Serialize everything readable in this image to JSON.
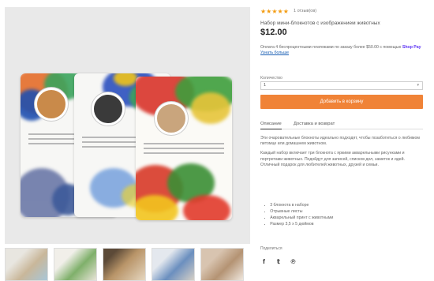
{
  "product": {
    "rating_stars": "★★★★★",
    "reviews": "1 отзыв(ов)",
    "title": "Набор мини-блокнотов с изображением животных",
    "price": "$12.00",
    "installment_prefix": "Оплата 4 беспроцентными платежами по заказу более $50.00 с помощью",
    "installment_brand": "Shop Pay",
    "installment_link": "Узнать больше",
    "variant_label": "Количество",
    "variant_value": "1",
    "add_to_cart": "Добавить в корзину"
  },
  "tabs": [
    {
      "label": "Описание"
    },
    {
      "label": "Доставка и возврат"
    }
  ],
  "description": {
    "p1": "Эти очаровательные блокноты идеально подходят, чтобы позаботиться о любимом питомце или домашнем животном.",
    "p2": "Каждый набор включает три блокнота с яркими акварельными рисунками и портретами животных. Подойдут для записей, списков дел, заметок и идей. Отличный подарок для любителей животных, друзей и семьи."
  },
  "features": [
    "3 блокнота в наборе",
    "Отрывные листы",
    "Акварельный принт с животными",
    "Размер 3,5 x 5 дюймов"
  ],
  "share": {
    "label": "Поделиться",
    "icons": [
      "facebook-icon",
      "twitter-icon",
      "pinterest-icon"
    ]
  },
  "colors": {
    "accent": "#f08337",
    "star": "#f39c12",
    "shoppay": "#5a31f4"
  }
}
